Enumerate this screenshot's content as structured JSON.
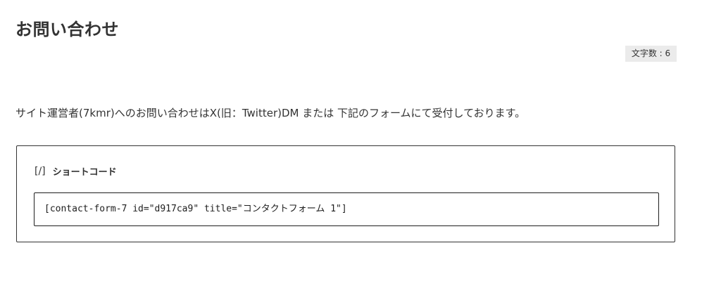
{
  "page": {
    "title": "お問い合わせ",
    "char_count": "文字数 : 6"
  },
  "content": {
    "intro": "サイト運営者(7kmr)へのお問い合わせはX(旧：Twitter)DM または 下記のフォームにて受付しております。"
  },
  "shortcode_block": {
    "icon": "[/]",
    "label": "ショートコード",
    "value": "[contact-form-7 id=\"d917ca9\" title=\"コンタクトフォーム 1\"]"
  }
}
